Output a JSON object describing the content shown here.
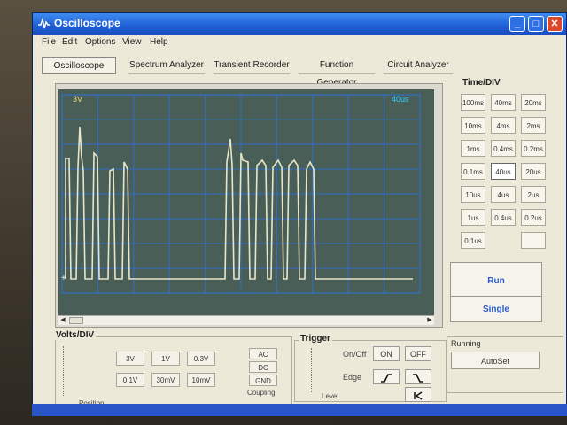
{
  "window": {
    "title": "Oscilloscope",
    "minimize": "_",
    "maximize": "□",
    "close": "✕"
  },
  "menu": [
    "File",
    "Edit",
    "Options",
    "View",
    "Help"
  ],
  "tabs": [
    "Oscilloscope",
    "Spectrum Analyzer",
    "Transient Recorder",
    "Function Generator",
    "Circuit Analyzer"
  ],
  "active_tab": "Oscilloscope",
  "screen": {
    "volts_readout": "3V",
    "time_readout": "40us",
    "marker": "+"
  },
  "time_div": {
    "label": "Time/DIV",
    "buttons": [
      "100ms",
      "40ms",
      "20ms",
      "10ms",
      "4ms",
      "2ms",
      "1ms",
      "0.4ms",
      "0.2ms",
      "0.1ms",
      "40us",
      "20us",
      "10us",
      "4us",
      "2us",
      "1us",
      "0.4us",
      "0.2us",
      "0.1us"
    ],
    "selected": "40us",
    "run": "Run",
    "single": "Single"
  },
  "volts_div": {
    "label": "Volts/DIV",
    "buttons": [
      "3V",
      "1V",
      "0.3V",
      "0.1V",
      "30mV",
      "10mV"
    ],
    "selected": "3V",
    "coupling": [
      "AC",
      "DC",
      "GND"
    ],
    "coupling_label": "Coupling",
    "position_label": "Position"
  },
  "trigger": {
    "label": "Trigger",
    "onoff_label": "On/Off",
    "on": "ON",
    "off": "OFF",
    "edge_label": "Edge",
    "level_label": "Level"
  },
  "status": {
    "running": "Running",
    "autoset": "AutoSet"
  },
  "colors": {
    "trace": "#e8e6c8",
    "grid": "#2a72d8",
    "screen_bg": "#4a5e58",
    "volts_readout": "#e6df7a",
    "time_readout": "#33ccff"
  }
}
